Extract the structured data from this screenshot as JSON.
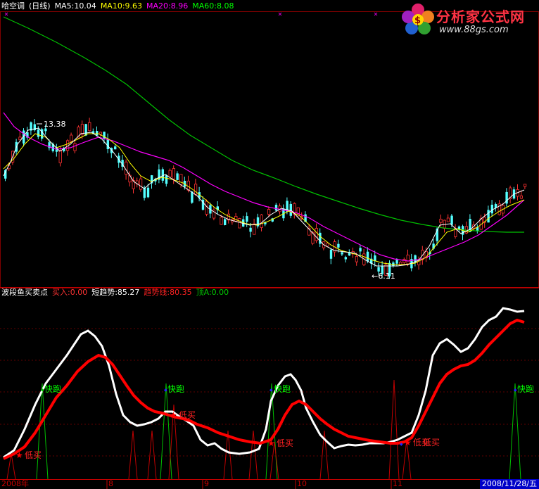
{
  "top_header": {
    "title": "哈空调",
    "period": "(日线)",
    "ma5": "MA5:10.04",
    "ma10": "MA10:9.63",
    "ma20": "MA20:8.96",
    "ma60": "MA60:8.08"
  },
  "price_labels": {
    "high": "13.38",
    "low": "←6.11"
  },
  "bottom_header": {
    "indicator": "波段鱼买卖点",
    "buy": "买入:0.00",
    "short_trend": "短趋势:85.27",
    "trend_line": "趋势线:80.35",
    "top_a": "顶A:0.00"
  },
  "signals": {
    "fast_run": "快跑",
    "low_buy": "低买"
  },
  "x_axis": [
    "2008年",
    "8",
    "9",
    "10",
    "11"
  ],
  "date_box": "2008/11/28/五",
  "logo": {
    "brand": "分析家公式网",
    "url": "www.88gs.com"
  },
  "colors": {
    "background": "#000000",
    "ma5": "#ffffff",
    "ma10": "#ffff00",
    "ma20": "#ff00ff",
    "ma60": "#00c000",
    "up": "#ff3232",
    "down": "#54ffff",
    "short_trend": "#ffffff",
    "trend_line": "#ff0000"
  }
}
